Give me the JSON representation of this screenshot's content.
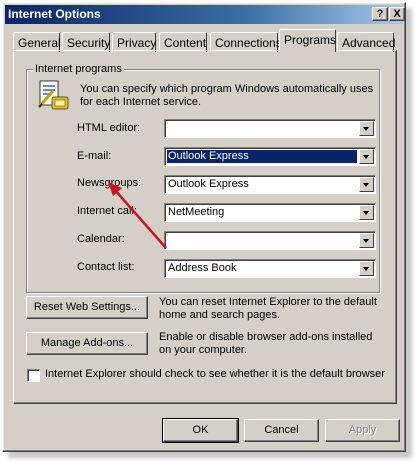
{
  "window": {
    "title": "Internet Options",
    "help_label": "?",
    "close_label": "X"
  },
  "tabs": [
    {
      "label": "General"
    },
    {
      "label": "Security"
    },
    {
      "label": "Privacy"
    },
    {
      "label": "Content"
    },
    {
      "label": "Connections"
    },
    {
      "label": "Programs",
      "active": true
    },
    {
      "label": "Advanced"
    }
  ],
  "programs": {
    "group_label": "Internet programs",
    "description": "You can specify which program Windows automatically uses for each Internet service.",
    "rows": [
      {
        "label": "HTML editor:",
        "value": ""
      },
      {
        "label": "E-mail:",
        "value": "Outlook Express",
        "selected": true
      },
      {
        "label": "Newsgroups:",
        "value": "Outlook Express"
      },
      {
        "label": "Internet call:",
        "value": "NetMeeting"
      },
      {
        "label": "Calendar:",
        "value": ""
      },
      {
        "label": "Contact list:",
        "value": "Address Book"
      }
    ]
  },
  "reset": {
    "button_label": "Reset Web Settings...",
    "description": "You can reset Internet Explorer to the default home and search pages."
  },
  "addons": {
    "button_label": "Manage Add-ons...",
    "description": "Enable or disable browser add-ons installed on your computer."
  },
  "default_check": {
    "label": "Internet Explorer should check to see whether it is the default browser",
    "checked": false
  },
  "footer": {
    "ok_label": "OK",
    "cancel_label": "Cancel",
    "apply_label": "Apply"
  },
  "annotation": {
    "arrow_color": "#cc1122"
  }
}
